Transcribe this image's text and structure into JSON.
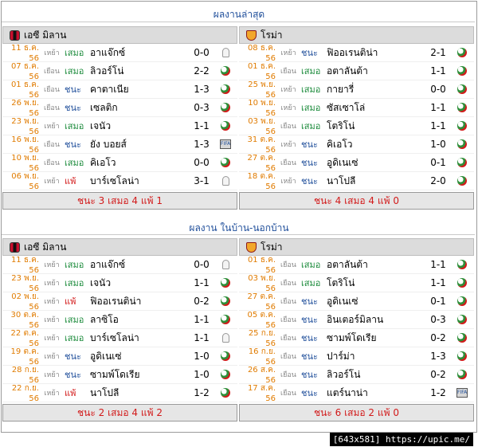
{
  "section1": {
    "title": "ผลงานล่าสุด",
    "left": {
      "team": "เอซี มิลาน",
      "summary": "ชนะ 3 เสมอ 4 แพ้ 1",
      "rows": [
        {
          "date": "11 ธ.ค. 56",
          "venue": "เหย้า",
          "result": "เสมอ",
          "result_type": "draw",
          "opponent": "อาแจ๊กซ์",
          "score": "0-0",
          "comp": "ucl"
        },
        {
          "date": "07 ธ.ค. 56",
          "venue": "เยือน",
          "result": "เสมอ",
          "result_type": "draw",
          "opponent": "ลิวอร์โน่",
          "score": "2-2",
          "comp": "league"
        },
        {
          "date": "01 ธ.ค. 56",
          "venue": "เยือน",
          "result": "ชนะ",
          "result_type": "win",
          "opponent": "คาตาเนีย",
          "score": "1-3",
          "comp": "league"
        },
        {
          "date": "26 พ.ย. 56",
          "venue": "เยือน",
          "result": "ชนะ",
          "result_type": "win",
          "opponent": "เซลติก",
          "score": "0-3",
          "comp": "league"
        },
        {
          "date": "23 พ.ย. 56",
          "venue": "เหย้า",
          "result": "เสมอ",
          "result_type": "draw",
          "opponent": "เจนัว",
          "score": "1-1",
          "comp": "league"
        },
        {
          "date": "16 พ.ย. 56",
          "venue": "เยือน",
          "result": "ชนะ",
          "result_type": "win",
          "opponent": "ยัง บอยส์",
          "score": "1-3",
          "comp": "fifa"
        },
        {
          "date": "10 พ.ย. 56",
          "venue": "เยือน",
          "result": "เสมอ",
          "result_type": "draw",
          "opponent": "คิเอโว",
          "score": "0-0",
          "comp": "league"
        },
        {
          "date": "06 พ.ย. 56",
          "venue": "เหย้า",
          "result": "แพ้",
          "result_type": "loss",
          "opponent": "บาร์เซโลน่า",
          "score": "3-1",
          "comp": "ucl"
        }
      ]
    },
    "right": {
      "team": "โรม่า",
      "summary": "ชนะ 4 เสมอ 4 แพ้ 0",
      "rows": [
        {
          "date": "08 ธ.ค. 56",
          "venue": "เหย้า",
          "result": "ชนะ",
          "result_type": "win",
          "opponent": "ฟิออเรนติน่า",
          "score": "2-1",
          "comp": "league"
        },
        {
          "date": "01 ธ.ค. 56",
          "venue": "เยือน",
          "result": "เสมอ",
          "result_type": "draw",
          "opponent": "อตาลันต้า",
          "score": "1-1",
          "comp": "league"
        },
        {
          "date": "25 พ.ย. 56",
          "venue": "เหย้า",
          "result": "เสมอ",
          "result_type": "draw",
          "opponent": "กายารี่",
          "score": "0-0",
          "comp": "league"
        },
        {
          "date": "10 พ.ย. 56",
          "venue": "เหย้า",
          "result": "เสมอ",
          "result_type": "draw",
          "opponent": "ซัสเซาโล่",
          "score": "1-1",
          "comp": "league"
        },
        {
          "date": "03 พ.ย. 56",
          "venue": "เยือน",
          "result": "เสมอ",
          "result_type": "draw",
          "opponent": "โตริโน่",
          "score": "1-1",
          "comp": "league"
        },
        {
          "date": "31 ต.ค. 56",
          "venue": "เหย้า",
          "result": "ชนะ",
          "result_type": "win",
          "opponent": "คิเอโว",
          "score": "1-0",
          "comp": "league"
        },
        {
          "date": "27 ต.ค. 56",
          "venue": "เยือน",
          "result": "ชนะ",
          "result_type": "win",
          "opponent": "อูดิเนเซ่",
          "score": "0-1",
          "comp": "league"
        },
        {
          "date": "18 ต.ค. 56",
          "venue": "เหย้า",
          "result": "ชนะ",
          "result_type": "win",
          "opponent": "นาโปลี",
          "score": "2-0",
          "comp": "league"
        }
      ]
    }
  },
  "section2": {
    "title": "ผลงาน ในบ้าน-นอกบ้าน",
    "left": {
      "team": "เอซี มิลาน",
      "summary": "ชนะ 2 เสมอ 4 แพ้ 2",
      "rows": [
        {
          "date": "11 ธ.ค. 56",
          "venue": "เหย้า",
          "result": "เสมอ",
          "result_type": "draw",
          "opponent": "อาแจ๊กซ์",
          "score": "0-0",
          "comp": "ucl"
        },
        {
          "date": "23 พ.ย. 56",
          "venue": "เหย้า",
          "result": "เสมอ",
          "result_type": "draw",
          "opponent": "เจนัว",
          "score": "1-1",
          "comp": "league"
        },
        {
          "date": "02 พ.ย. 56",
          "venue": "เหย้า",
          "result": "แพ้",
          "result_type": "loss",
          "opponent": "ฟิออเรนติน่า",
          "score": "0-2",
          "comp": "league"
        },
        {
          "date": "30 ต.ค. 56",
          "venue": "เหย้า",
          "result": "เสมอ",
          "result_type": "draw",
          "opponent": "ลาซิโอ",
          "score": "1-1",
          "comp": "league"
        },
        {
          "date": "22 ต.ค. 56",
          "venue": "เหย้า",
          "result": "เสมอ",
          "result_type": "draw",
          "opponent": "บาร์เซโลน่า",
          "score": "1-1",
          "comp": "ucl"
        },
        {
          "date": "19 ต.ค. 56",
          "venue": "เหย้า",
          "result": "ชนะ",
          "result_type": "win",
          "opponent": "อูดิเนเซ่",
          "score": "1-0",
          "comp": "league"
        },
        {
          "date": "28 ก.ย. 56",
          "venue": "เหย้า",
          "result": "ชนะ",
          "result_type": "win",
          "opponent": "ซามพ์โดเรีย",
          "score": "1-0",
          "comp": "league"
        },
        {
          "date": "22 ก.ย. 56",
          "venue": "เหย้า",
          "result": "แพ้",
          "result_type": "loss",
          "opponent": "นาโปลี",
          "score": "1-2",
          "comp": "league"
        }
      ]
    },
    "right": {
      "team": "โรม่า",
      "summary": "ชนะ 6 เสมอ 2 แพ้ 0",
      "rows": [
        {
          "date": "01 ธ.ค. 56",
          "venue": "เยือน",
          "result": "เสมอ",
          "result_type": "draw",
          "opponent": "อตาลันต้า",
          "score": "1-1",
          "comp": "league"
        },
        {
          "date": "03 พ.ย. 56",
          "venue": "เยือน",
          "result": "เสมอ",
          "result_type": "draw",
          "opponent": "โตริโน่",
          "score": "1-1",
          "comp": "league"
        },
        {
          "date": "27 ต.ค. 56",
          "venue": "เยือน",
          "result": "ชนะ",
          "result_type": "win",
          "opponent": "อูดิเนเซ่",
          "score": "0-1",
          "comp": "league"
        },
        {
          "date": "05 ต.ค. 56",
          "venue": "เยือน",
          "result": "ชนะ",
          "result_type": "win",
          "opponent": "อินเตอร์มิลาน",
          "score": "0-3",
          "comp": "league"
        },
        {
          "date": "25 ก.ย. 56",
          "venue": "เยือน",
          "result": "ชนะ",
          "result_type": "win",
          "opponent": "ซามพ์โดเรีย",
          "score": "0-2",
          "comp": "league"
        },
        {
          "date": "16 ก.ย. 56",
          "venue": "เยือน",
          "result": "ชนะ",
          "result_type": "win",
          "opponent": "ปาร์ม่า",
          "score": "1-3",
          "comp": "league"
        },
        {
          "date": "26 ส.ค. 56",
          "venue": "เยือน",
          "result": "ชนะ",
          "result_type": "win",
          "opponent": "ลิวอร์โน่",
          "score": "0-2",
          "comp": "league"
        },
        {
          "date": "17 ส.ค. 56",
          "venue": "เยือน",
          "result": "ชนะ",
          "result_type": "win",
          "opponent": "แตร์นาน่า",
          "score": "1-2",
          "comp": "fifa"
        }
      ]
    }
  },
  "colors": {
    "win": "#1f4e9a",
    "draw": "#1a8a3a",
    "loss": "#d21a1a",
    "date": "#e07b00",
    "title": "#1f4e9a"
  },
  "watermark": "[643x581] https://upic.me/"
}
